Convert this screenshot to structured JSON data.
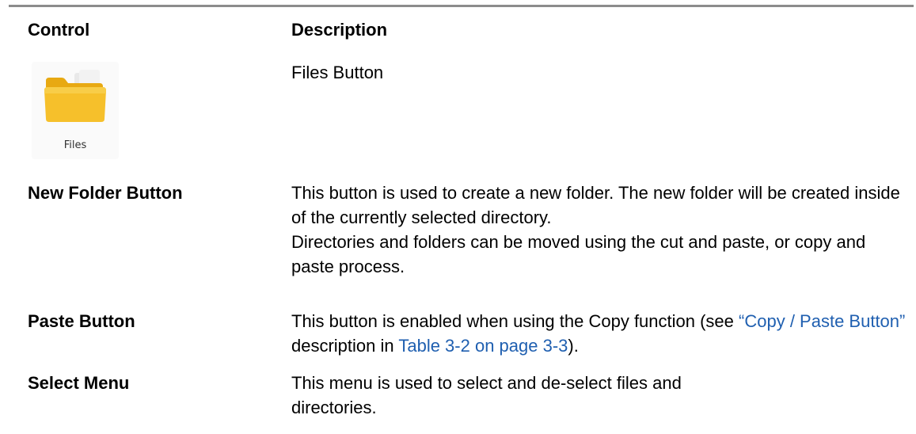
{
  "table": {
    "header": {
      "control": "Control",
      "description": "Description"
    },
    "rows": [
      {
        "control_icon": "files-folder-icon",
        "control_icon_label": "Files",
        "description": [
          "Files Button"
        ]
      },
      {
        "control": "New Folder Button",
        "description": [
          "This button is used to create a new folder. The new folder will be created inside of the currently selected directory.",
          "Directories and folders can be moved using the cut and paste, or copy and paste process."
        ]
      },
      {
        "control": "Paste Button",
        "description": {
          "text_before": "This button is enabled when using the Copy function (see ",
          "link1": "“Copy / Paste Button”",
          "text_middle": " description in ",
          "link2": "Table 3-2 on page 3-3",
          "text_after": ")."
        }
      },
      {
        "control": "Select Menu",
        "description": [
          "This menu is used to select and de-select files and directories."
        ]
      }
    ]
  },
  "colors": {
    "rule": "#8c8c8c",
    "link": "#1f5fb0",
    "folder": "#f6bf26",
    "folder_dark": "#e8a912"
  }
}
